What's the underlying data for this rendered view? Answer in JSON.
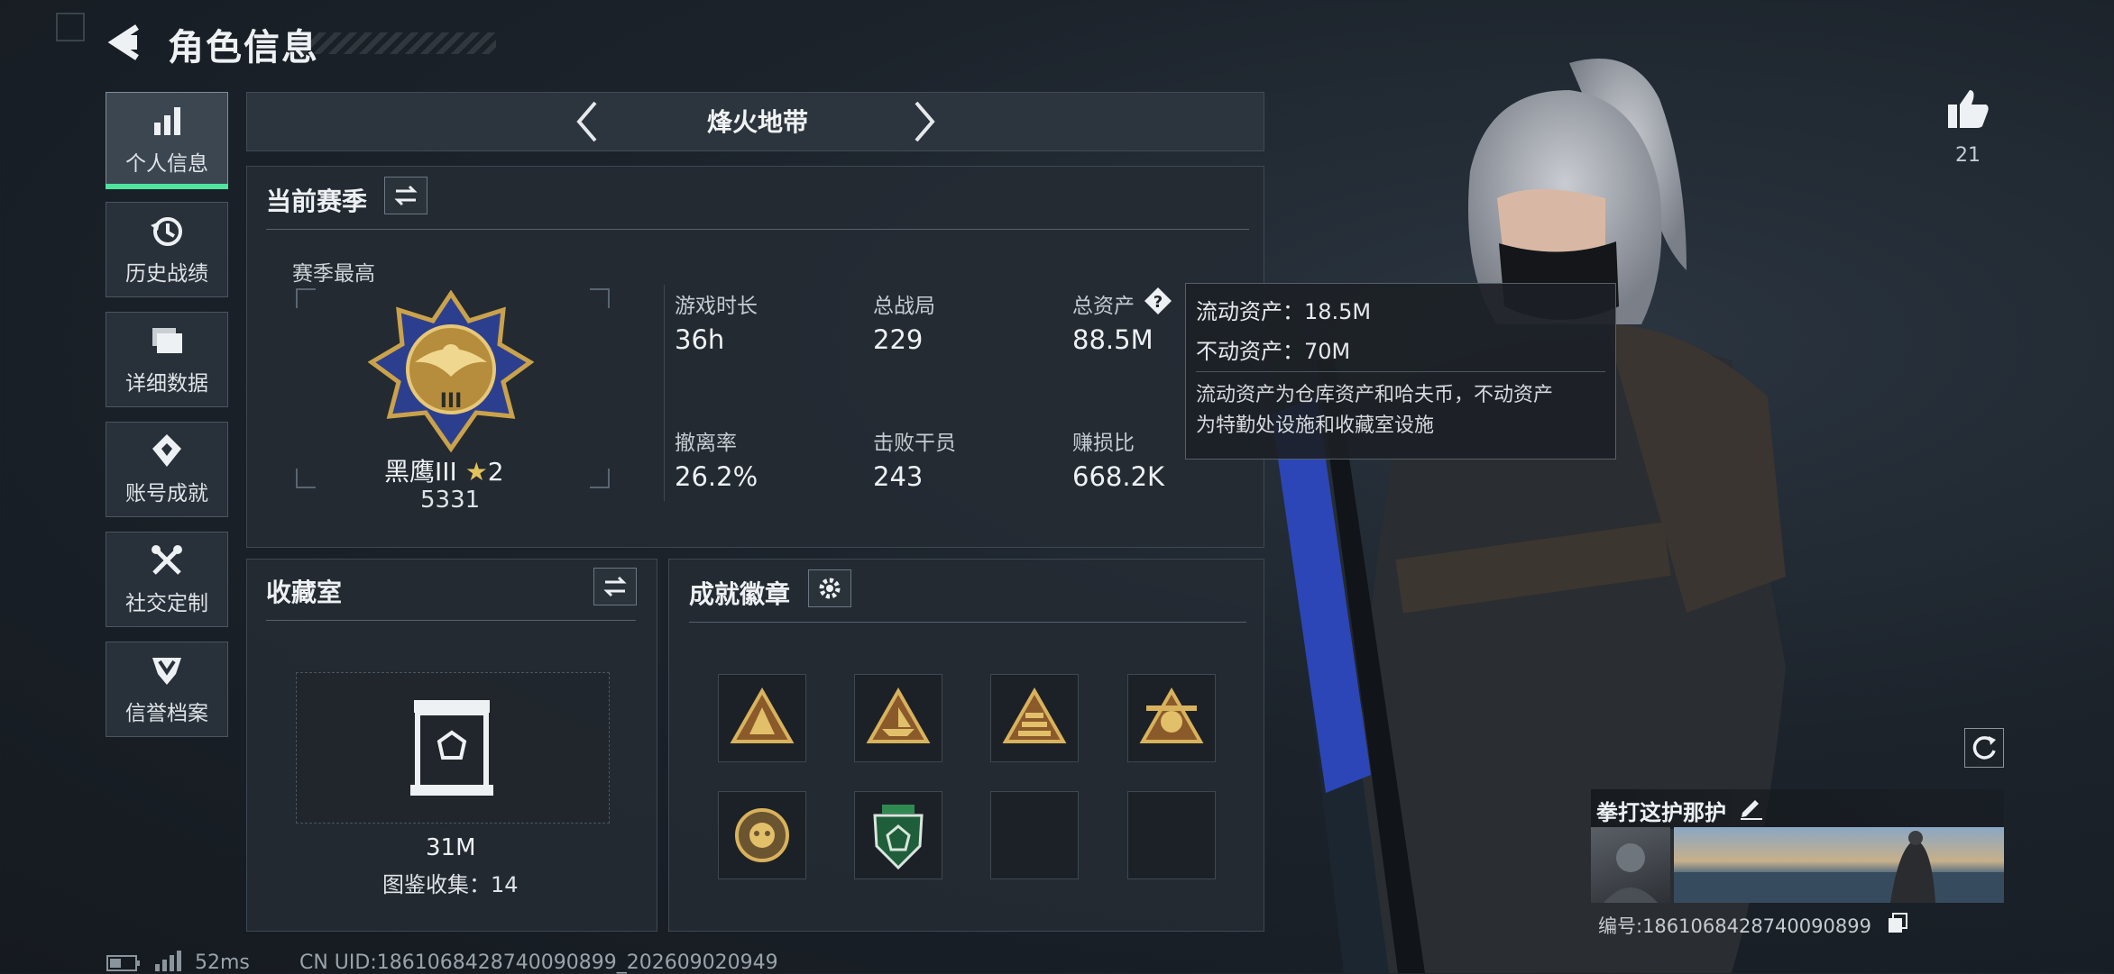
{
  "header": {
    "title": "角色信息"
  },
  "sidebar": {
    "items": [
      {
        "label": "个人信息",
        "icon": "bar-chart-icon",
        "active": true
      },
      {
        "label": "历史战绩",
        "icon": "history-clock-icon"
      },
      {
        "label": "详细数据",
        "icon": "folder-icon"
      },
      {
        "label": "账号成就",
        "icon": "achievement-icon"
      },
      {
        "label": "社交定制",
        "icon": "tools-icon"
      },
      {
        "label": "信誉档案",
        "icon": "shield-icon"
      }
    ]
  },
  "mode": {
    "title": "烽火地带"
  },
  "season": {
    "title": "当前赛季",
    "best_label": "赛季最高",
    "rank_name": "黑鹰III",
    "rank_stars": "2",
    "rank_points": "5331",
    "stats": [
      {
        "label": "游戏时长",
        "value": "36h"
      },
      {
        "label": "总战局",
        "value": "229"
      },
      {
        "label": "总资产",
        "value": "88.5M"
      },
      {
        "label": "撤离率",
        "value": "26.2%"
      },
      {
        "label": "击败干员",
        "value": "243"
      },
      {
        "label": "赚损比",
        "value": "668.2K"
      }
    ]
  },
  "tooltip": {
    "liquid": "流动资产：18.5M",
    "fixed": "不动资产：70M",
    "desc_1": "流动资产为仓库资产和哈夫币，不动资产",
    "desc_2": "为特勤处设施和收藏室设施"
  },
  "collection": {
    "title": "收藏室",
    "value": "31M",
    "codex": "图鉴收集：14"
  },
  "badges": {
    "title": "成就徽章",
    "slots": [
      {
        "icon": "gold-triangle-badge-icon"
      },
      {
        "icon": "gold-ship-badge-icon"
      },
      {
        "icon": "gold-pyramid-badge-icon"
      },
      {
        "icon": "gold-skull-badge-icon"
      },
      {
        "icon": "gold-round-emblem-icon"
      },
      {
        "icon": "green-shield-badge-icon"
      },
      {
        "icon": "empty-slot"
      },
      {
        "icon": "empty-slot"
      }
    ]
  },
  "like": {
    "count": "21"
  },
  "card": {
    "name": "拳打这护那护",
    "number": "编号:1861068428740090899"
  },
  "status": {
    "ping": "52ms",
    "uid": "CN UID:1861068428740090899_202609020949"
  },
  "colors": {
    "accent_green": "#4fe39e",
    "gold": "#c9a24a"
  }
}
